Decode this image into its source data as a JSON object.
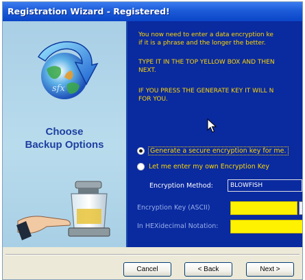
{
  "window": {
    "title": "Registration Wizard - Registered!"
  },
  "sidebar": {
    "heading_line1": "Choose",
    "heading_line2": "Backup Options",
    "logo_icon": "globe-arrow-logo-icon",
    "illustration_icon": "hand-coffee-maker-illustration"
  },
  "instructions": {
    "line1": "You now need to enter a data encryption ke",
    "line2": "if it is a phrase and the longer the better.",
    "line3": "TYPE IT IN THE TOP YELLOW BOX AND THEN",
    "line4": "NEXT.",
    "line5": "IF YOU PRESS THE GENERATE KEY IT WILL N",
    "line6": "FOR YOU."
  },
  "options": {
    "generate_label": "Generate a secure encryption key for me.",
    "manual_label": "Let me enter my own Encryption Key",
    "selected": "generate"
  },
  "encryption": {
    "method_label": "Encryption Method:",
    "method_value": "BLOWFISH",
    "key_ascii_label": "Encryption Key (ASCII)",
    "key_ascii_value": "",
    "key_hex_label": "In HEXidecimal Notation:",
    "key_hex_value": ""
  },
  "buttons": {
    "cancel": "Cancel",
    "back": "< Back",
    "next": "Next >"
  },
  "colors": {
    "title_bar": "#1c5bd8",
    "panel_blue": "#0a2aa0",
    "text_yellow": "#ffd700",
    "field_yellow": "#fff200",
    "sidebar_blue": "#b9dced",
    "heading_blue": "#1e3fa0"
  }
}
